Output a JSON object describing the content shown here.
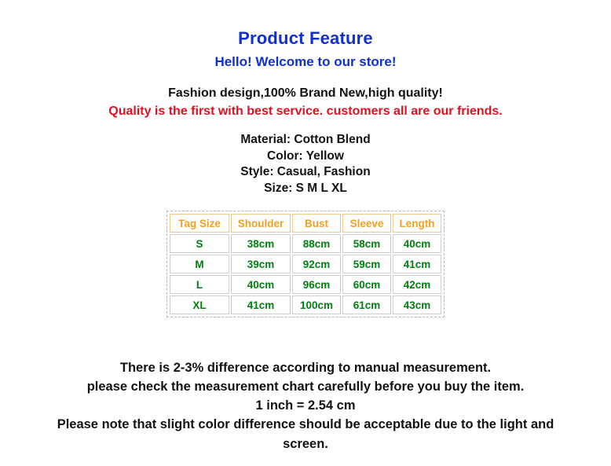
{
  "header": {
    "title": "Product Feature",
    "subtitle": "Hello! Welcome to our store!"
  },
  "promo": {
    "line_black": "Fashion design,100%  Brand New,high  quality!",
    "line_red": "Quality is the first with best service. customers all are our friends."
  },
  "specs": {
    "material": "Material: Cotton Blend",
    "color": "Color: Yellow",
    "style": "Style: Casual, Fashion",
    "size": "Size: S M L XL"
  },
  "size_table": {
    "headers": [
      "Tag Size",
      "Shoulder",
      "Bust",
      "Sleeve",
      "Length"
    ],
    "rows": [
      [
        "S",
        "38cm",
        "88cm",
        "58cm",
        "40cm"
      ],
      [
        "M",
        "39cm",
        "92cm",
        "59cm",
        "41cm"
      ],
      [
        "L",
        "40cm",
        "96cm",
        "60cm",
        "42cm"
      ],
      [
        "XL",
        "41cm",
        "100cm",
        "61cm",
        "43cm"
      ]
    ]
  },
  "notes": {
    "line1": "There is 2-3% difference according to manual measurement.",
    "line2": "please check the measurement chart carefully before you buy the item.",
    "line3": "1 inch = 2.54 cm",
    "line4": "Please note that slight color difference should be acceptable due to the light and",
    "line5": "screen."
  },
  "colors": {
    "title_blue": "#1030d0",
    "promo_red": "#e01020",
    "table_header_orange": "#f0a020",
    "table_value_green": "#007f10",
    "text_black": "#121212",
    "table_outer_border": "#b5b5b5",
    "cell_border_gray": "#cfcfcf",
    "header_cell_border": "#f3c98a",
    "background": "#ffffff"
  }
}
